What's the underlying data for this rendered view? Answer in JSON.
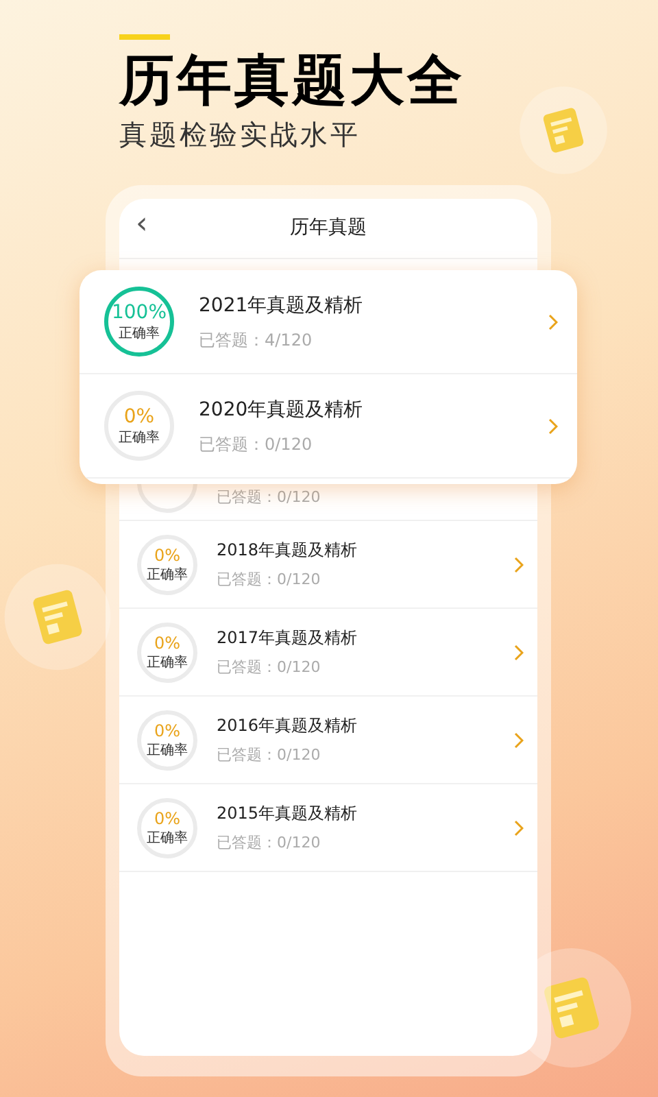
{
  "headline": {
    "title": "历年真题大全",
    "subtitle": "真题检验实战水平"
  },
  "screen": {
    "title": "历年真题",
    "back_icon": "‹"
  },
  "highlighted_rows": [
    {
      "title": "2021年真题及精析",
      "answered": "已答题：4/120",
      "percent": "100%",
      "rate_label": "正确率",
      "ring_complete": true
    },
    {
      "title": "2020年真题及精析",
      "answered": "已答题：0/120",
      "percent": "0%",
      "rate_label": "正确率",
      "ring_complete": false
    }
  ],
  "rows": [
    {
      "kind": "covered",
      "answered": "已答题：0/120",
      "ring_complete": false
    },
    {
      "kind": "full",
      "title": "2018年真题及精析",
      "answered": "已答题：0/120",
      "percent": "0%",
      "rate_label": "正确率",
      "ring_complete": false
    },
    {
      "kind": "full",
      "title": "2017年真题及精析",
      "answered": "已答题：0/120",
      "percent": "0%",
      "rate_label": "正确率",
      "ring_complete": false
    },
    {
      "kind": "full",
      "title": "2016年真题及精析",
      "answered": "已答题：0/120",
      "percent": "0%",
      "rate_label": "正确率",
      "ring_complete": false
    },
    {
      "kind": "full",
      "title": "2015年真题及精析",
      "answered": "已答题：0/120",
      "percent": "0%",
      "rate_label": "正确率",
      "ring_complete": false
    }
  ]
}
